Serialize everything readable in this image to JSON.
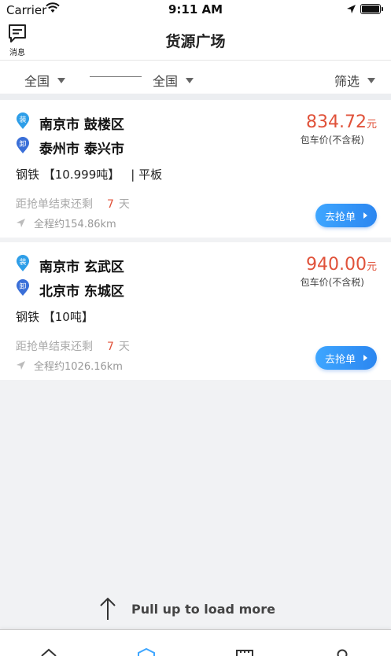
{
  "status": {
    "carrier": "Carrier",
    "time": "9:11 AM"
  },
  "header": {
    "msg_label": "消息",
    "title": "货源广场"
  },
  "filters": {
    "from": "全国",
    "to": "全国",
    "screen": "筛选"
  },
  "orders": [
    {
      "load_city": "南京市 鼓楼区",
      "unload_city": "泰州市 泰兴市",
      "price": "834.72",
      "price_unit": "元",
      "price_note": "包车价(不含税)",
      "cargo": "钢铁 【10.999吨】",
      "vehicle": "| 平板",
      "remain_label": "距抢单结束还剩",
      "remain_days": "7",
      "remain_unit": "天",
      "distance": "全程约154.86km",
      "button": "去抢单"
    },
    {
      "load_city": "南京市 玄武区",
      "unload_city": "北京市 东城区",
      "price": "940.00",
      "price_unit": "元",
      "price_note": "包车价(不含税)",
      "cargo": "钢铁 【10吨】",
      "vehicle": "",
      "remain_label": "距抢单结束还剩",
      "remain_days": "7",
      "remain_unit": "天",
      "distance": "全程约1026.16km",
      "button": "去抢单"
    }
  ],
  "pins": {
    "load": "装",
    "unload": "卸"
  },
  "load_more": "Pull up to load more",
  "colors": {
    "accent": "#2b86f0",
    "price": "#e0523a"
  }
}
